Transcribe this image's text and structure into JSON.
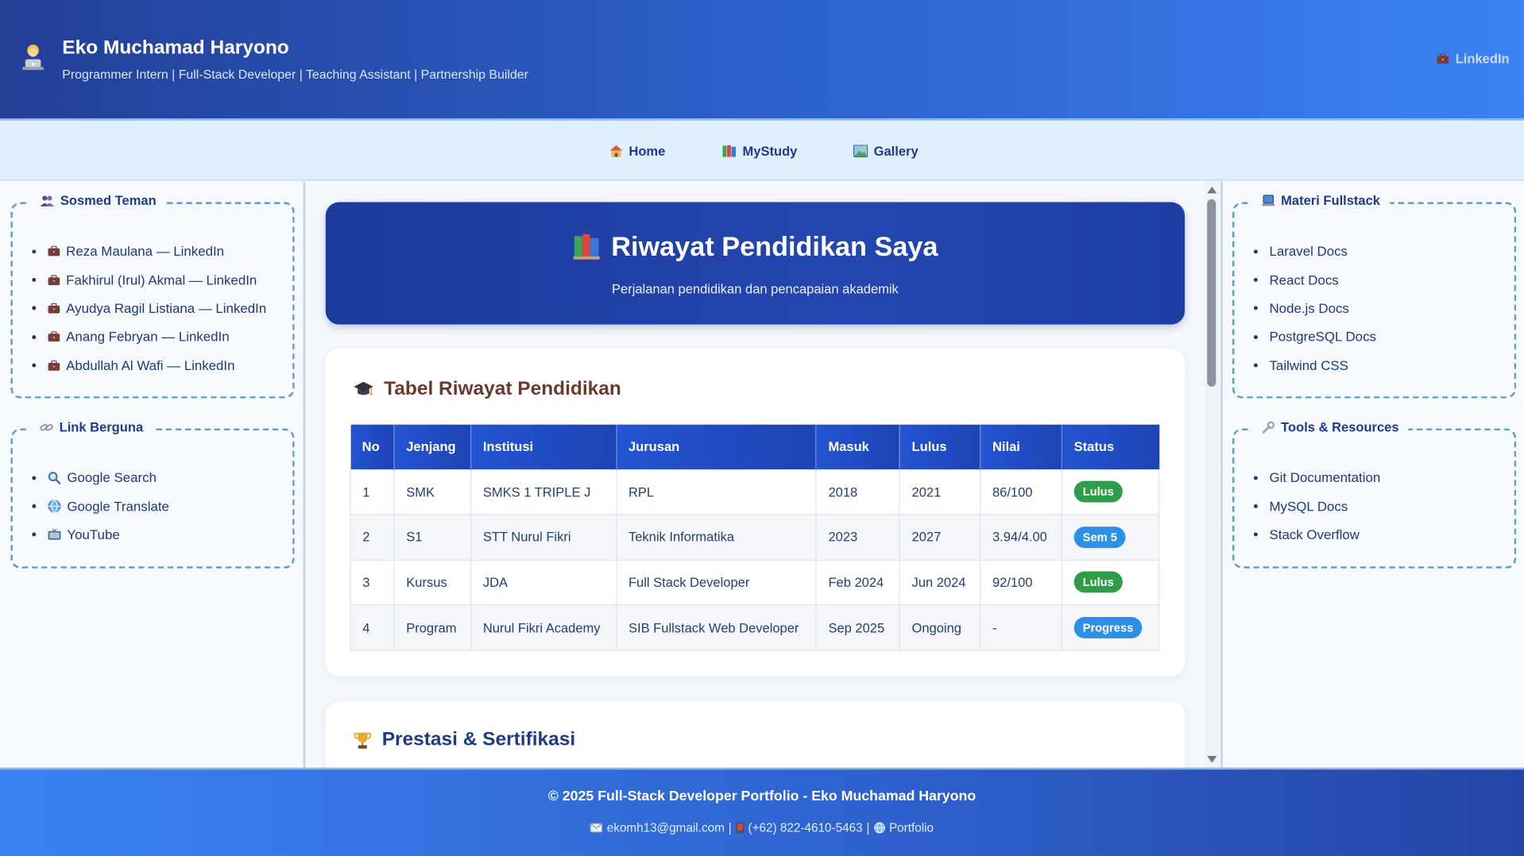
{
  "header": {
    "name": "Eko Muchamad Haryono",
    "tagline": "Programmer Intern | Full-Stack Developer | Teaching Assistant | Partnership Builder",
    "linkedin_label": "LinkedIn"
  },
  "nav": {
    "items": [
      {
        "label": "Home",
        "icon": "house-icon"
      },
      {
        "label": "MyStudy",
        "icon": "books-icon"
      },
      {
        "label": "Gallery",
        "icon": "picture-icon"
      }
    ]
  },
  "sidebar_left": {
    "friends": {
      "title": "Sosmed Teman",
      "items": [
        "Reza Maulana — LinkedIn",
        "Fakhirul (Irul) Akmal — LinkedIn",
        "Ayudya Ragil Listiana — LinkedIn",
        "Anang Febryan — LinkedIn",
        "Abdullah Al Wafi — LinkedIn"
      ]
    },
    "links": {
      "title": "Link Berguna",
      "items": [
        {
          "label": "Google Search",
          "icon": "magnifier-icon"
        },
        {
          "label": "Google Translate",
          "icon": "globe-icon"
        },
        {
          "label": "YouTube",
          "icon": "tv-icon"
        }
      ]
    }
  },
  "sidebar_right": {
    "materi": {
      "title": "Materi Fullstack",
      "items": [
        "Laravel Docs",
        "React Docs",
        "Node.js Docs",
        "PostgreSQL Docs",
        "Tailwind CSS"
      ]
    },
    "tools": {
      "title": "Tools & Resources",
      "items": [
        "Git Documentation",
        "MySQL Docs",
        "Stack Overflow"
      ]
    }
  },
  "hero": {
    "title": "Riwayat Pendidikan Saya",
    "subtitle": "Perjalanan pendidikan dan pencapaian akademik"
  },
  "education": {
    "title": "Tabel Riwayat Pendidikan",
    "columns": [
      "No",
      "Jenjang",
      "Institusi",
      "Jurusan",
      "Masuk",
      "Lulus",
      "Nilai",
      "Status"
    ],
    "rows": [
      {
        "no": "1",
        "jenjang": "SMK",
        "institusi": "SMKS 1 TRIPLE J",
        "jurusan": "RPL",
        "masuk": "2018",
        "lulus": "2021",
        "nilai": "86/100",
        "status": "Lulus",
        "status_color": "#2f9c4a"
      },
      {
        "no": "2",
        "jenjang": "S1",
        "institusi": "STT Nurul Fikri",
        "jurusan": "Teknik Informatika",
        "masuk": "2023",
        "lulus": "2027",
        "nilai": "3.94/4.00",
        "status": "Sem 5",
        "status_color": "#2c8fe8"
      },
      {
        "no": "3",
        "jenjang": "Kursus",
        "institusi": "JDA",
        "jurusan": "Full Stack Developer",
        "masuk": "Feb 2024",
        "lulus": "Jun 2024",
        "nilai": "92/100",
        "status": "Lulus",
        "status_color": "#2f9c4a"
      },
      {
        "no": "4",
        "jenjang": "Program",
        "institusi": "Nurul Fikri Academy",
        "jurusan": "SIB Fullstack Web Developer",
        "masuk": "Sep 2025",
        "lulus": "Ongoing",
        "nilai": "-",
        "status": "Progress",
        "status_color": "#2c8fe8"
      }
    ]
  },
  "achievements": {
    "title": "Prestasi & Sertifikasi"
  },
  "footer": {
    "copyright": "© 2025 Full-Stack Developer Portfolio - Eko Muchamad Haryono",
    "email": "ekomh13@gmail.com",
    "phone": "(+62) 822-4610-5463",
    "portfolio": "Portfolio",
    "separator": "|"
  },
  "colors": {
    "header_bg": "#2e63d0",
    "hero_bg": "#2346b0",
    "accent_text": "#1f3a8a",
    "badge_green": "#2f9c4a",
    "badge_blue": "#2c8fe8"
  }
}
